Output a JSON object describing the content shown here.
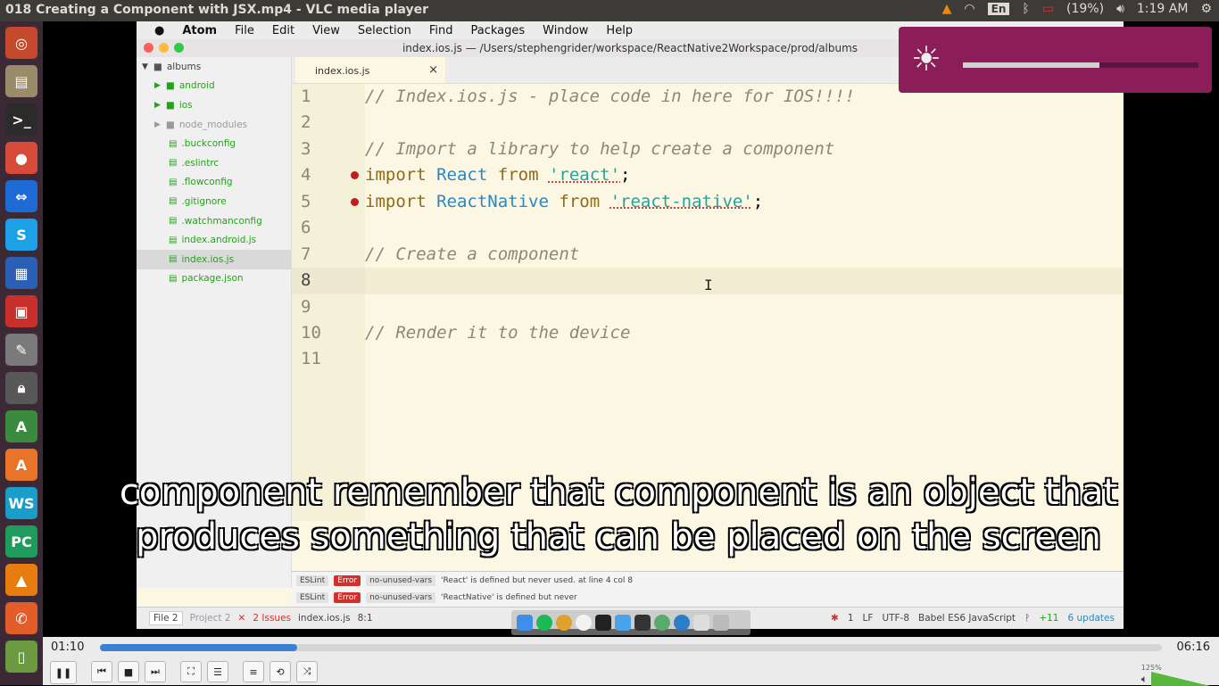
{
  "window_title": "018 Creating a Component with JSX.mp4 - VLC media player",
  "tray": {
    "keyboard": "En",
    "battery": "(19%)",
    "clock": "1:19 AM"
  },
  "launcher": [
    "ubuntu",
    "files",
    "terminal",
    "chrome",
    "teamviewer",
    "skype",
    "writer",
    "apps",
    "settings",
    "lock",
    "android-studio",
    "software",
    "webstorm",
    "pycharm",
    "vlc",
    "tools",
    "disk"
  ],
  "mac_menu": [
    "Atom",
    "File",
    "Edit",
    "View",
    "Selection",
    "Find",
    "Packages",
    "Window",
    "Help"
  ],
  "atom": {
    "title": "index.ios.js — /Users/stephengrider/workspace/ReactNative2Workspace/prod/albums",
    "tree": {
      "root": "albums",
      "folders": [
        "android",
        "ios",
        "node_modules"
      ],
      "files": [
        ".buckconfig",
        ".eslintrc",
        ".flowconfig",
        ".gitignore",
        ".watchmanconfig",
        "index.android.js",
        "index.ios.js",
        "package.json"
      ]
    },
    "tab": {
      "label": "index.ios.js",
      "close": "×"
    },
    "line_numbers": [
      "1",
      "2",
      "3",
      "4",
      "5",
      "6",
      "7",
      "8",
      "9",
      "10",
      "11"
    ],
    "code": {
      "l1": "// Index.ios.js - place code in here for IOS!!!!",
      "l3": "// Import a library to help create a component",
      "l4_kw": "import",
      "l4_id": "React",
      "l4_from": "from",
      "l4_str": "'react'",
      "l4_end": ";",
      "l5_kw": "import",
      "l5_id": "ReactNative",
      "l5_from": "from",
      "l5_str": "'react-native'",
      "l5_end": ";",
      "l7": "// Create a component",
      "l10": "// Render it to the device"
    },
    "errors": [
      {
        "linter": "ESLint",
        "level": "Error",
        "rule": "no-unused-vars",
        "msg": "'React' is defined but never used. at line 4 col 8"
      },
      {
        "linter": "ESLint",
        "level": "Error",
        "rule": "no-unused-vars",
        "msg": "'ReactNative' is defined but never"
      }
    ],
    "status": {
      "file": "File 2",
      "project": "Project 2",
      "issues": "2 Issues",
      "filename": "index.ios.js",
      "cursor": "8:1",
      "bugs": "1",
      "eol": "LF",
      "encoding": "UTF-8",
      "grammar": "Babel ES6 JavaScript",
      "git": "+11",
      "updates": "6 updates"
    }
  },
  "brightness_level": 0.58,
  "subtitle": "component remember that component is an object that produces something that can be placed on the screen",
  "player": {
    "current_time": "01:10",
    "total_time": "06:16",
    "progress": 0.186,
    "volume": "125%"
  },
  "colors": {
    "vlc_accent": "#3b80d4",
    "overlay": "#8b1d59",
    "error": "#d0312d"
  }
}
